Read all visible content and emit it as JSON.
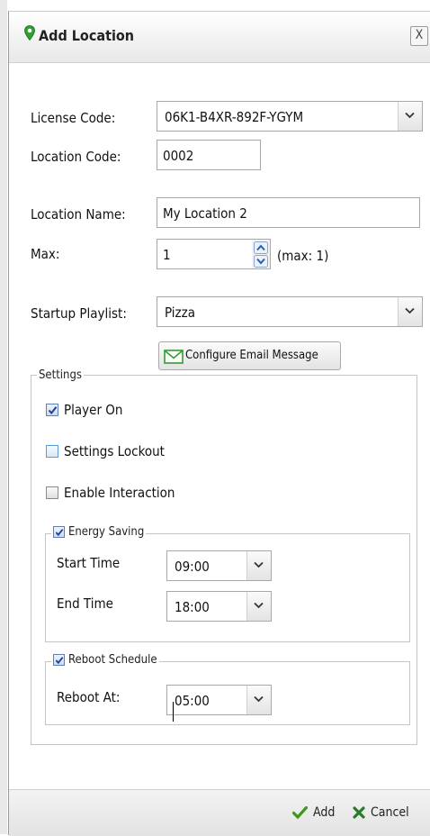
{
  "dialog": {
    "title": "Add Location",
    "close_label": "X"
  },
  "form": {
    "license_code": {
      "label": "License Code:",
      "value": "06K1-B4XR-892F-YGYM"
    },
    "location_code": {
      "label": "Location Code:",
      "value": "0002"
    },
    "location_name": {
      "label": "Location Name:",
      "value": "My Location 2"
    },
    "max": {
      "label": "Max:",
      "value": "1",
      "note": "(max: 1)"
    },
    "startup_playlist": {
      "label": "Startup Playlist:",
      "value": "Pizza"
    },
    "configure_email_label": "Configure Email Message"
  },
  "settings": {
    "legend": "Settings",
    "player_on": {
      "label": "Player On",
      "checked": true
    },
    "settings_lockout": {
      "label": "Settings Lockout",
      "checked": false
    },
    "enable_interaction": {
      "label": "Enable Interaction",
      "checked": false
    },
    "energy_saving": {
      "legend": "Energy Saving",
      "checked": true,
      "start_time": {
        "label": "Start Time",
        "value": "09:00"
      },
      "end_time": {
        "label": "End Time",
        "value": "18:00"
      }
    },
    "reboot_schedule": {
      "legend": "Reboot Schedule",
      "checked": true,
      "reboot_at": {
        "label": "Reboot At:",
        "value": "05:00"
      }
    }
  },
  "footer": {
    "add_label": "Add",
    "cancel_label": "Cancel"
  },
  "colors": {
    "pin_green": "#2e9e2e",
    "check_green": "#3a9a1c",
    "cancel_green": "#2c7a2c",
    "checkbox_blue": "#5b7fb6"
  },
  "icons": {
    "title": "location-pin-icon",
    "email": "envelope-icon",
    "add": "checkmark-icon",
    "cancel": "x-icon"
  }
}
